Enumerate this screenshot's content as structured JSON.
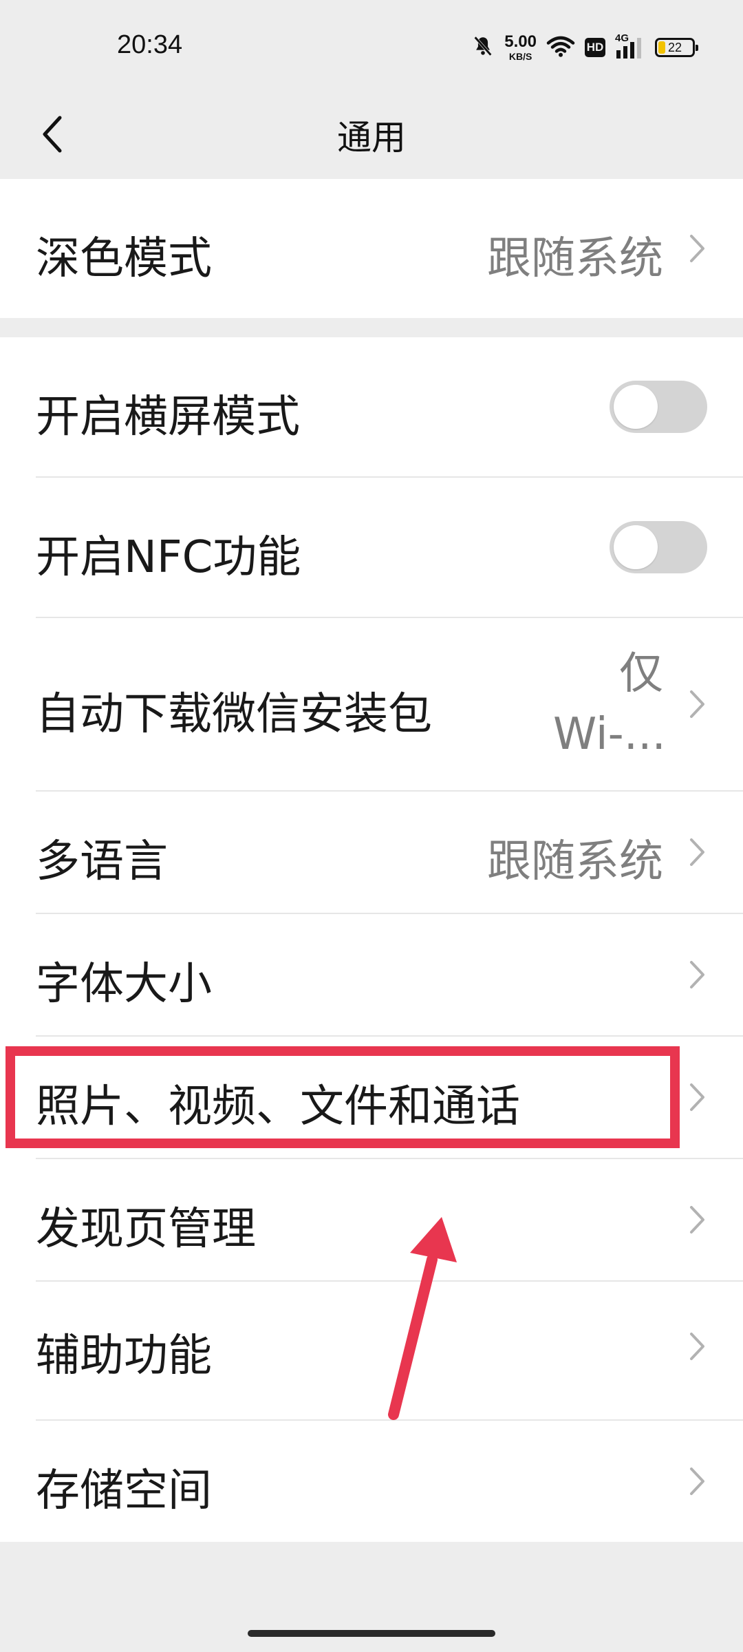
{
  "status_bar": {
    "time": "20:34",
    "net_speed_value": "5.00",
    "net_speed_unit": "KB/S",
    "hd_label": "HD",
    "network_label": "4G",
    "battery_level": "22",
    "icons": [
      "mute-bell-icon",
      "wifi-icon",
      "hd-icon",
      "signal-icon",
      "battery-icon"
    ]
  },
  "nav": {
    "title": "通用",
    "back_icon": "chevron-left-icon"
  },
  "settings": {
    "dark_mode": {
      "label": "深色模式",
      "value": "跟随系统"
    },
    "landscape": {
      "label": "开启横屏模式",
      "enabled": false
    },
    "nfc": {
      "label": "开启NFC功能",
      "enabled": false
    },
    "auto_download": {
      "label": "自动下载微信安装包",
      "value": "仅Wi-..."
    },
    "language": {
      "label": "多语言",
      "value": "跟随系统"
    },
    "font_size": {
      "label": "字体大小"
    },
    "media": {
      "label": "照片、视频、文件和通话"
    },
    "discover": {
      "label": "发现页管理"
    },
    "accessibility": {
      "label": "辅助功能"
    },
    "storage": {
      "label": "存储空间"
    }
  },
  "annotation": {
    "highlight_color": "#e8364f"
  },
  "colors": {
    "background": "#ededed",
    "card": "#ffffff",
    "value_text": "#7f7f7f",
    "toggle_off": "#d4d4d4"
  }
}
